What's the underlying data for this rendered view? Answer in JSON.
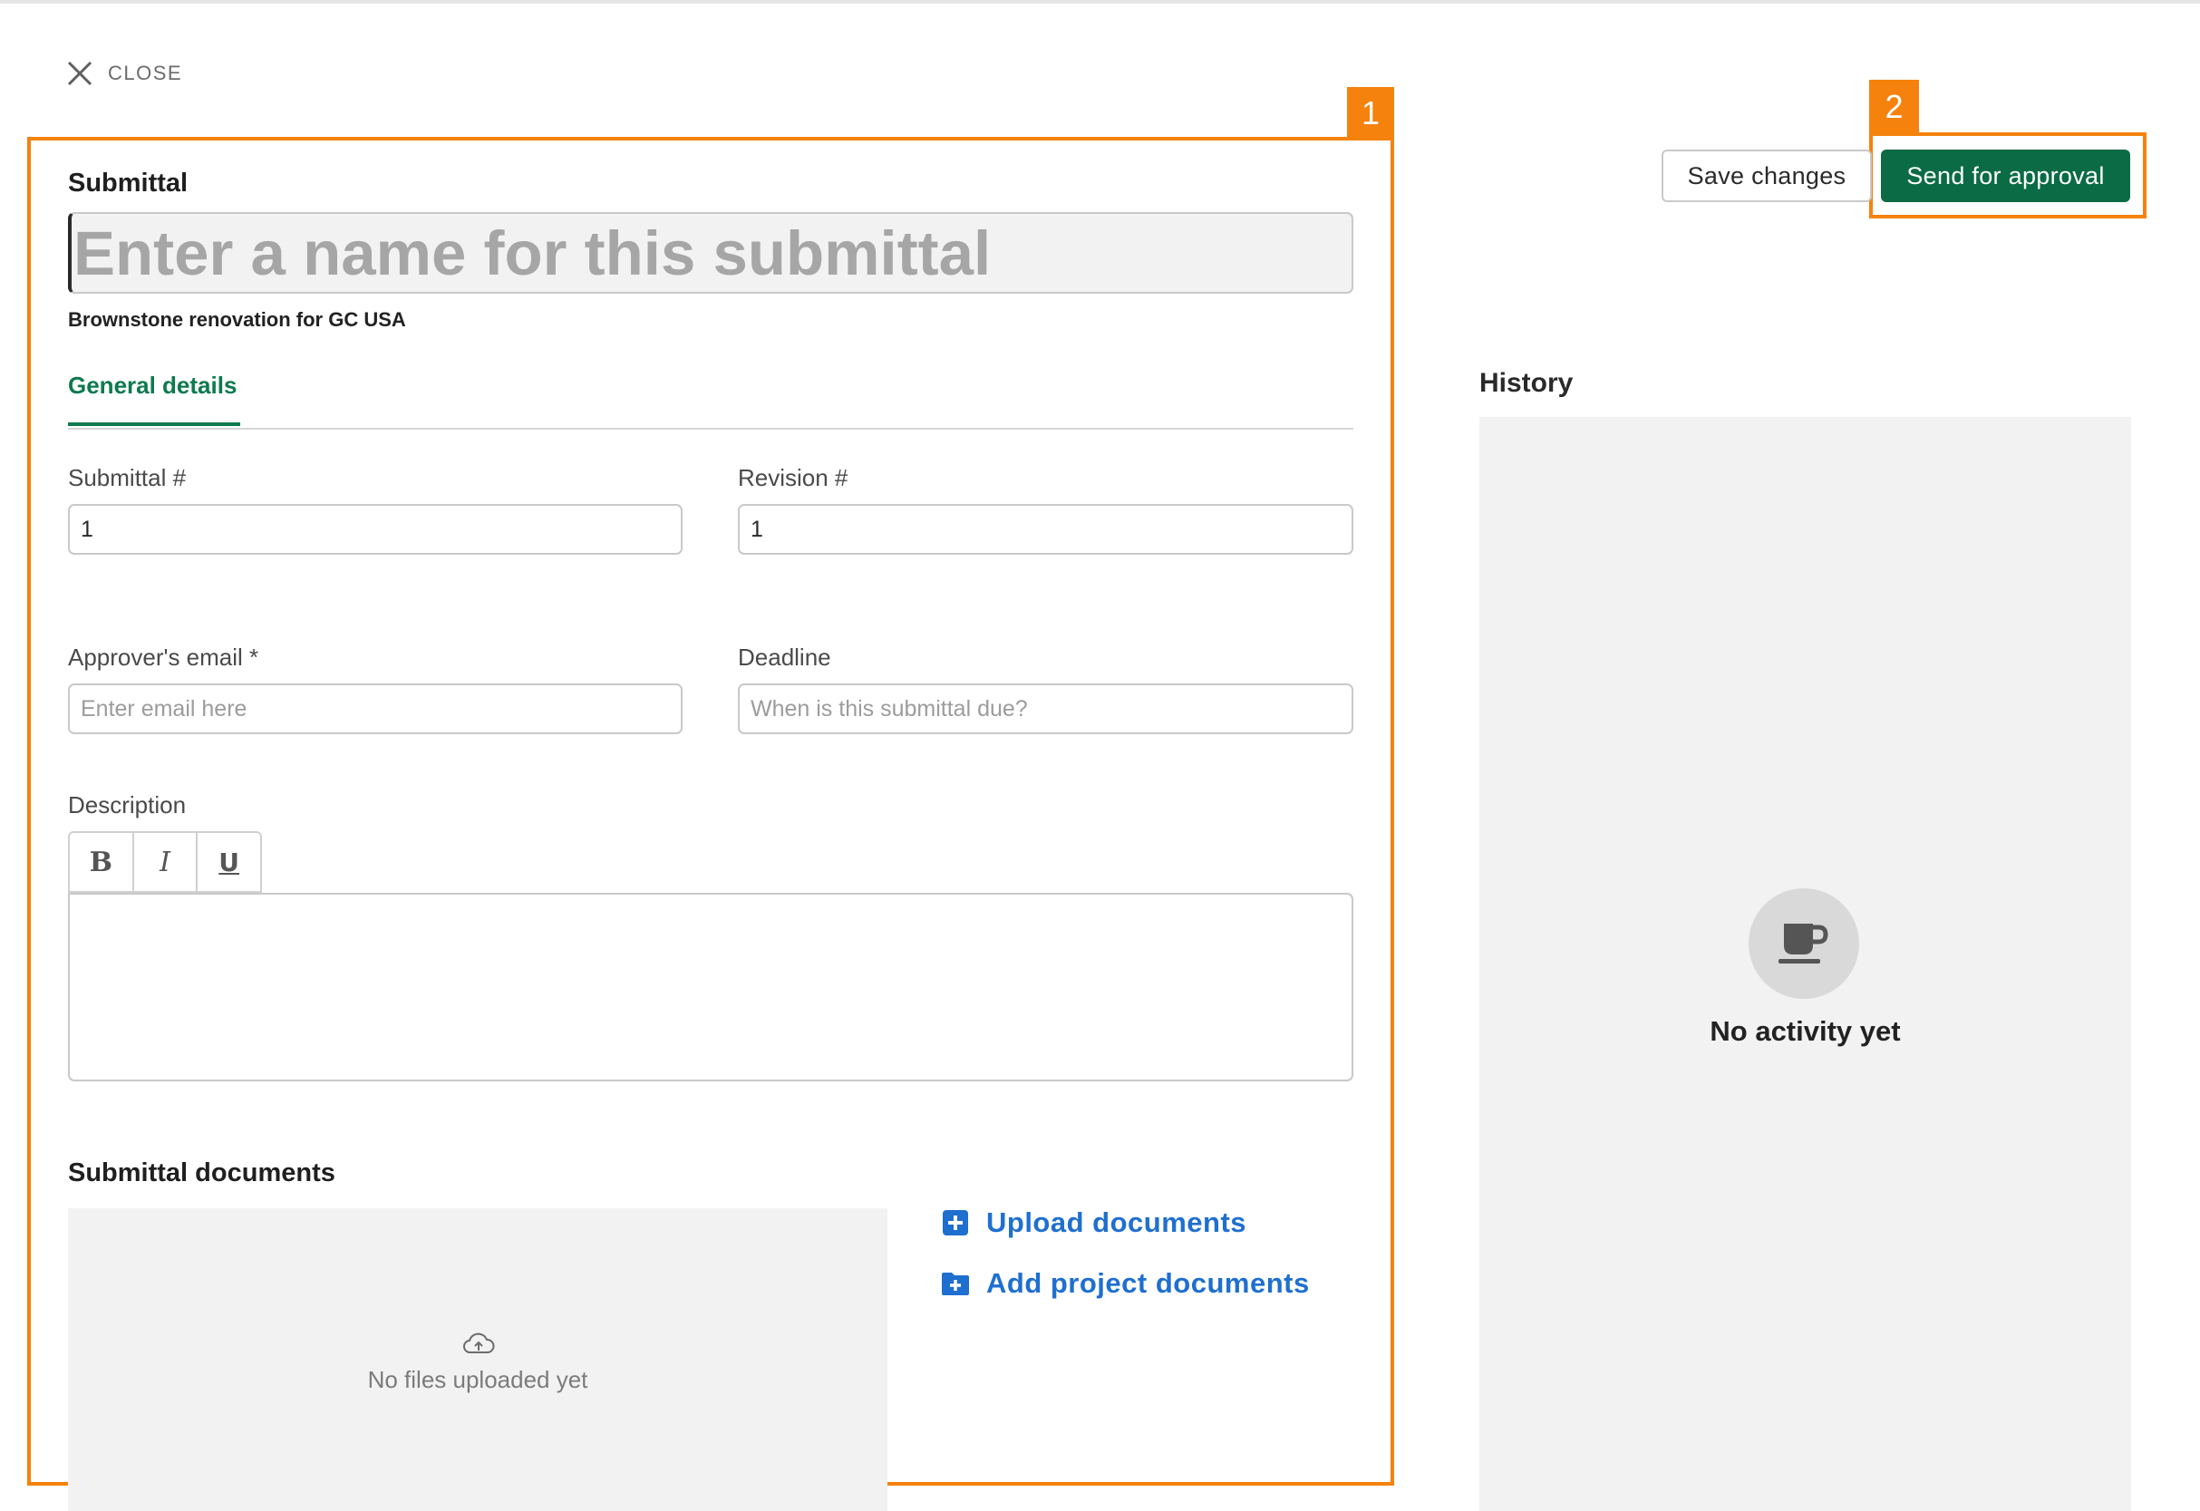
{
  "header": {
    "close_label": "CLOSE"
  },
  "annotations": {
    "box1_label": "1",
    "box2_label": "2",
    "color": "#f5820d"
  },
  "form": {
    "section_title": "Submittal",
    "name_placeholder": "Enter a name for this submittal",
    "project_name": "Brownstone renovation for GC USA",
    "tabs": [
      {
        "label": "General details",
        "active": true
      }
    ],
    "submittal_number": {
      "label": "Submittal #",
      "value": "1"
    },
    "revision_number": {
      "label": "Revision #",
      "value": "1"
    },
    "approver_email": {
      "label": "Approver's email *",
      "placeholder": "Enter email here"
    },
    "deadline": {
      "label": "Deadline",
      "placeholder": "When is this submittal due?"
    },
    "description": {
      "label": "Description",
      "toolbar": [
        "B",
        "I",
        "U"
      ]
    }
  },
  "documents": {
    "title": "Submittal documents",
    "empty_text": "No files uploaded yet",
    "upload_label": "Upload documents",
    "add_project_label": "Add project documents"
  },
  "actions": {
    "save_label": "Save changes",
    "send_label": "Send for approval"
  },
  "history": {
    "title": "History",
    "empty_text": "No activity yet"
  },
  "colors": {
    "accent_green": "#0b6b45",
    "tab_green": "#0e7a4f",
    "link_blue": "#1f6fd0",
    "annotation_orange": "#f5820d"
  }
}
